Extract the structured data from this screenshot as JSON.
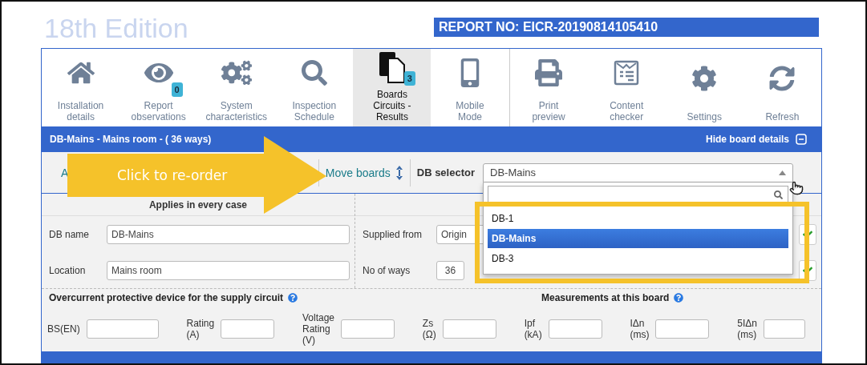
{
  "title": "18th Edition",
  "report_no": "REPORT NO: EICR-20190814105410",
  "toolbar_groups": [
    [
      {
        "kind": "home",
        "label": "Installation\ndetails",
        "selected": false
      },
      {
        "kind": "eye",
        "label": "Report\nobservations",
        "badge": "0",
        "selected": false
      },
      {
        "kind": "gears",
        "label": "System\ncharacteristics",
        "selected": false
      },
      {
        "kind": "search",
        "label": "Inspection\nSchedule",
        "selected": false
      },
      {
        "kind": "boards",
        "label": "Boards\nCircuits -\nResults",
        "badge": "3",
        "selected": true
      },
      {
        "kind": "mobile",
        "label": "Mobile\nMode",
        "selected": false
      }
    ],
    [
      {
        "kind": "print",
        "label": "Print\npreview",
        "selected": false
      },
      {
        "kind": "checker",
        "label": "Content\nchecker",
        "selected": false
      },
      {
        "kind": "settings",
        "label": "Settings",
        "selected": false
      },
      {
        "kind": "refresh",
        "label": "Refresh",
        "selected": false
      }
    ]
  ],
  "board_header": {
    "title": "DB-Mains - Mains room - ( 36 ways)",
    "hide_label": "Hide board details"
  },
  "action_bar": {
    "first_link": "A",
    "move_label": "Move boards",
    "selector_label": "DB selector",
    "selector_value": "DB-Mains",
    "options": [
      {
        "label": "DB-1",
        "selected": false
      },
      {
        "label": "DB-Mains",
        "selected": true
      },
      {
        "label": "DB-3",
        "selected": false
      }
    ]
  },
  "callout": "Click to re-order",
  "section_header": "Applies in every case",
  "rows": [
    {
      "label": "DB name",
      "value": "DB-Mains",
      "right_label": "Supplied from",
      "right_value": "Origin",
      "tick": true
    },
    {
      "label": "Location",
      "value": "Mains room",
      "right_label": "No of ways",
      "right_value": "36",
      "tick": true
    }
  ],
  "device_heading": "Overcurrent protective device for the supply circuit",
  "measurements_heading": "Measurements at this board",
  "device_fields": [
    {
      "label": "BS(EN)"
    },
    {
      "label": "Rating\n(A)"
    },
    {
      "label": "Voltage\nRating\n(V)"
    },
    {
      "label": "Zs\n(Ω)"
    },
    {
      "label": "Ipf\n(kA)"
    },
    {
      "label": "IΔn\n(ms)"
    },
    {
      "label": "5IΔn\n(ms)"
    }
  ]
}
